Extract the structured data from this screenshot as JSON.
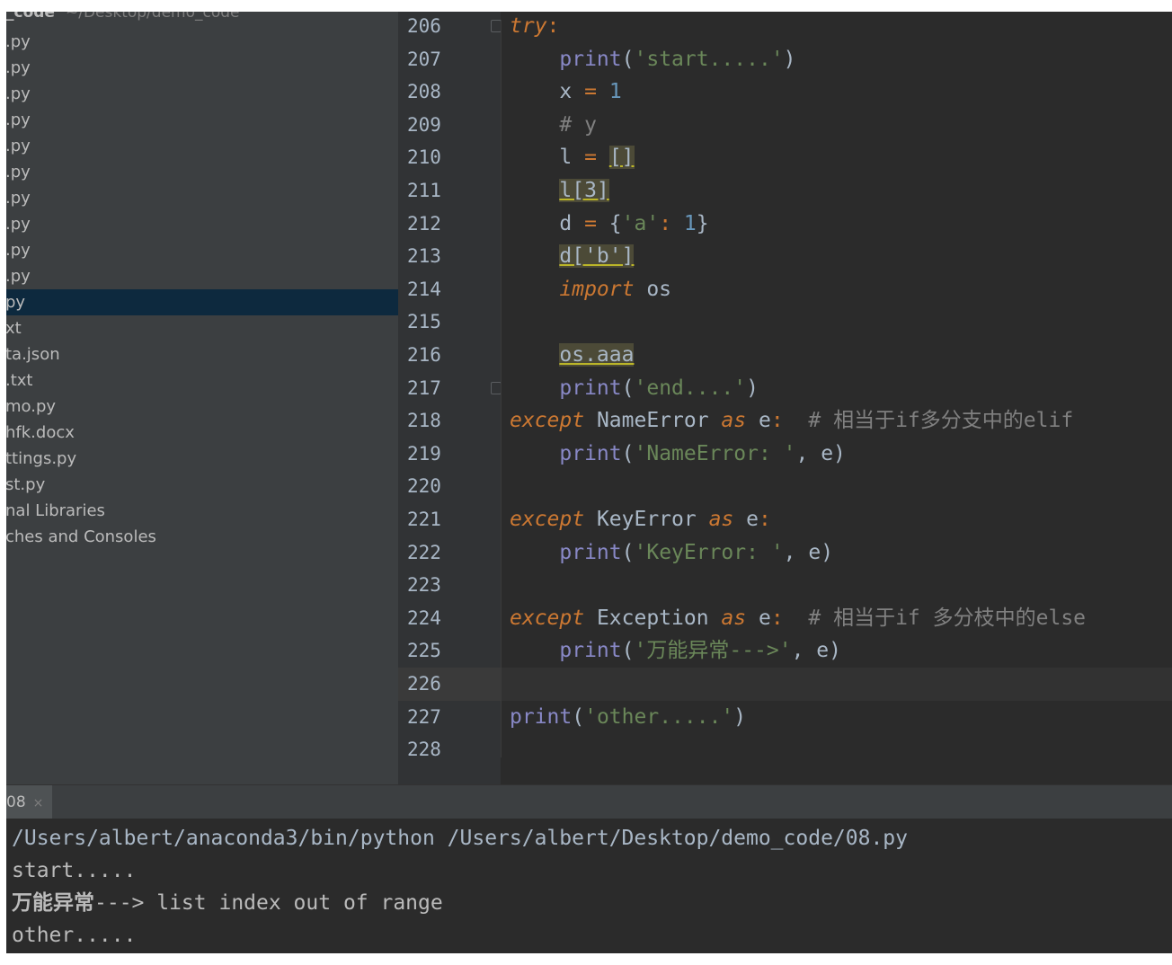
{
  "sidebar": {
    "project_name": "_code",
    "project_path": "~/Desktop/demo_code",
    "items": [
      {
        "label": ".py",
        "selected": false
      },
      {
        "label": ".py",
        "selected": false
      },
      {
        "label": ".py",
        "selected": false
      },
      {
        "label": ".py",
        "selected": false
      },
      {
        "label": ".py",
        "selected": false
      },
      {
        "label": ".py",
        "selected": false
      },
      {
        "label": ".py",
        "selected": false
      },
      {
        "label": ".py",
        "selected": false
      },
      {
        "label": ".py",
        "selected": false
      },
      {
        "label": ".py",
        "selected": false
      },
      {
        "label": "py",
        "selected": true
      },
      {
        "label": "xt",
        "selected": false
      },
      {
        "label": "ta.json",
        "selected": false
      },
      {
        "label": ".txt",
        "selected": false
      },
      {
        "label": "mo.py",
        "selected": false
      },
      {
        "label": "hfk.docx",
        "selected": false
      },
      {
        "label": "ttings.py",
        "selected": false
      },
      {
        "label": "st.py",
        "selected": false
      },
      {
        "label": "nal Libraries",
        "selected": false
      },
      {
        "label": "ches and Consoles",
        "selected": false
      }
    ]
  },
  "editor": {
    "current_line": "226",
    "lines": [
      {
        "num": "206",
        "tokens": [
          {
            "t": "try",
            "c": "kw"
          },
          {
            "t": ":",
            "c": "op"
          }
        ]
      },
      {
        "num": "207",
        "tokens": [
          {
            "t": "    "
          },
          {
            "t": "print",
            "c": "bi"
          },
          {
            "t": "("
          },
          {
            "t": "'start.....'",
            "c": "str"
          },
          {
            "t": ")"
          }
        ]
      },
      {
        "num": "208",
        "tokens": [
          {
            "t": "    x "
          },
          {
            "t": "=",
            "c": "op"
          },
          {
            "t": " "
          },
          {
            "t": "1",
            "c": "num"
          }
        ]
      },
      {
        "num": "209",
        "tokens": [
          {
            "t": "    "
          },
          {
            "t": "# y",
            "c": "cmt"
          }
        ]
      },
      {
        "num": "210",
        "tokens": [
          {
            "t": "    l "
          },
          {
            "t": "=",
            "c": "op"
          },
          {
            "t": " "
          },
          {
            "t": "[]",
            "c": "warn"
          }
        ]
      },
      {
        "num": "211",
        "tokens": [
          {
            "t": "    "
          },
          {
            "t": "l[3]",
            "c": "warn"
          }
        ]
      },
      {
        "num": "212",
        "tokens": [
          {
            "t": "    d "
          },
          {
            "t": "=",
            "c": "op"
          },
          {
            "t": " {"
          },
          {
            "t": "'a'",
            "c": "str"
          },
          {
            "t": ":",
            "c": "op"
          },
          {
            "t": " "
          },
          {
            "t": "1",
            "c": "num"
          },
          {
            "t": "}"
          }
        ]
      },
      {
        "num": "213",
        "tokens": [
          {
            "t": "    "
          },
          {
            "t": "d['b']",
            "c": "warn"
          }
        ]
      },
      {
        "num": "214",
        "tokens": [
          {
            "t": "    "
          },
          {
            "t": "import",
            "c": "kw"
          },
          {
            "t": " os"
          }
        ]
      },
      {
        "num": "215",
        "tokens": []
      },
      {
        "num": "216",
        "tokens": [
          {
            "t": "    "
          },
          {
            "t": "os.aaa",
            "c": "warn"
          }
        ]
      },
      {
        "num": "217",
        "tokens": [
          {
            "t": "    "
          },
          {
            "t": "print",
            "c": "bi"
          },
          {
            "t": "("
          },
          {
            "t": "'end....'",
            "c": "str"
          },
          {
            "t": ")"
          }
        ]
      },
      {
        "num": "218",
        "tokens": [
          {
            "t": "except",
            "c": "kw"
          },
          {
            "t": " NameError "
          },
          {
            "t": "as",
            "c": "kw"
          },
          {
            "t": " e"
          },
          {
            "t": ":",
            "c": "op"
          },
          {
            "t": "  "
          },
          {
            "t": "# 相当于if多分支中的elif",
            "c": "cmt"
          }
        ]
      },
      {
        "num": "219",
        "tokens": [
          {
            "t": "    "
          },
          {
            "t": "print",
            "c": "bi"
          },
          {
            "t": "("
          },
          {
            "t": "'NameError: '",
            "c": "str"
          },
          {
            "t": ", e)"
          }
        ]
      },
      {
        "num": "220",
        "tokens": []
      },
      {
        "num": "221",
        "tokens": [
          {
            "t": "except",
            "c": "kw"
          },
          {
            "t": " KeyError "
          },
          {
            "t": "as",
            "c": "kw"
          },
          {
            "t": " e"
          },
          {
            "t": ":",
            "c": "op"
          }
        ]
      },
      {
        "num": "222",
        "tokens": [
          {
            "t": "    "
          },
          {
            "t": "print",
            "c": "bi"
          },
          {
            "t": "("
          },
          {
            "t": "'KeyError: '",
            "c": "str"
          },
          {
            "t": ", e)"
          }
        ]
      },
      {
        "num": "223",
        "tokens": []
      },
      {
        "num": "224",
        "tokens": [
          {
            "t": "except",
            "c": "kw"
          },
          {
            "t": " Exception "
          },
          {
            "t": "as",
            "c": "kw"
          },
          {
            "t": " e"
          },
          {
            "t": ":",
            "c": "op"
          },
          {
            "t": "  "
          },
          {
            "t": "# 相当于if 多分枝中的else",
            "c": "cmt"
          }
        ]
      },
      {
        "num": "225",
        "tokens": [
          {
            "t": "    "
          },
          {
            "t": "print",
            "c": "bi"
          },
          {
            "t": "("
          },
          {
            "t": "'万能异常--->'",
            "c": "str"
          },
          {
            "t": ", e)"
          }
        ]
      },
      {
        "num": "226",
        "tokens": []
      },
      {
        "num": "227",
        "tokens": [
          {
            "t": "print",
            "c": "bi"
          },
          {
            "t": "("
          },
          {
            "t": "'other.....'",
            "c": "str"
          },
          {
            "t": ")"
          }
        ]
      },
      {
        "num": "228",
        "tokens": []
      }
    ]
  },
  "run": {
    "tab_label": "08",
    "close_glyph": "×",
    "command": "/Users/albert/anaconda3/bin/python /Users/albert/Desktop/demo_code/08.py",
    "output": [
      "start.....",
      "万能异常---> list index out of range",
      "other....."
    ]
  },
  "colors": {
    "background": "#2b2b2b",
    "sidebar": "#3c3f41",
    "selection": "#0d293e",
    "keyword": "#cc7832",
    "string": "#6a8759",
    "number": "#6897bb",
    "builtin": "#8888c6",
    "comment": "#808080"
  }
}
